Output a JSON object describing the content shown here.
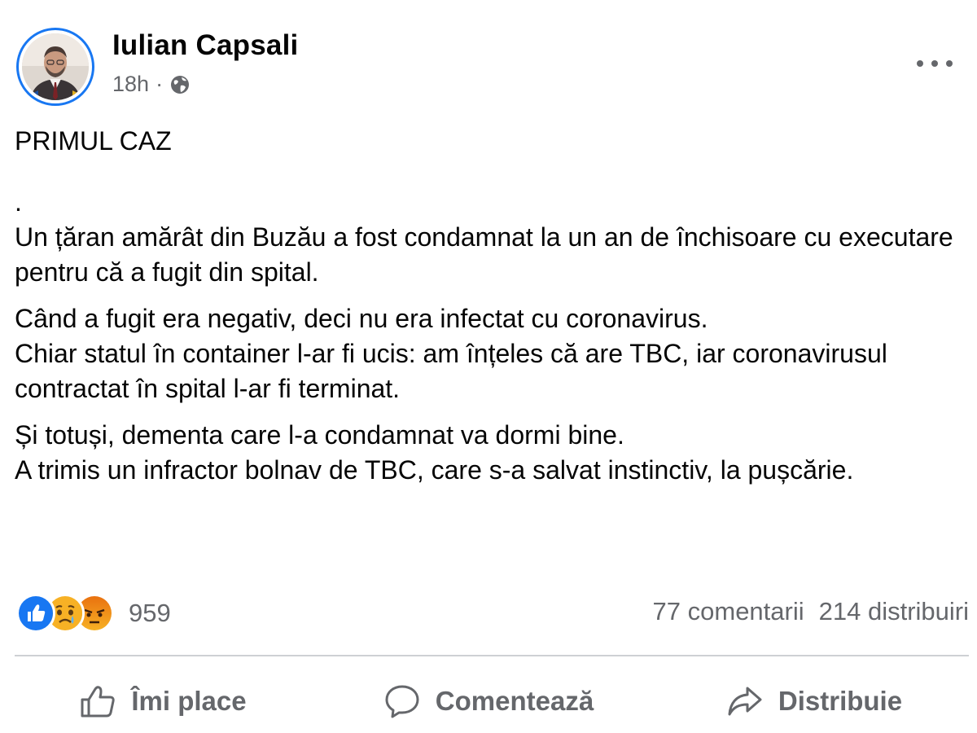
{
  "post": {
    "author": "Iulian Capsali",
    "time": "18h",
    "separator": "·",
    "privacy_icon": "globe-icon",
    "body": {
      "title": "PRIMUL CAZ",
      "dot": ".",
      "p1": "Un țăran amărât din Buzău a fost condamnat la un an de închisoare cu executare pentru că a fugit din spital.",
      "p2_l1": "Când a fugit era negativ, deci nu era infectat cu coronavirus.",
      "p2_l2": "Chiar statul în container l-ar fi ucis: am înțeles că are TBC, iar coronavirusul contractat în spital l-ar fi terminat.",
      "p3_l1": "Și totuși, dementa care l-a condamnat va dormi bine.",
      "p3_l2": "A trimis un infractor bolnav de TBC, care s-a salvat instinctiv, la pușcărie."
    },
    "reactions": {
      "icons": [
        "like-icon",
        "sad-icon",
        "angry-icon"
      ],
      "count": "959"
    },
    "stats": {
      "comments": "77 comentarii",
      "shares": "214 distribuiri"
    },
    "actions": {
      "like": "Îmi place",
      "comment": "Comentează",
      "share": "Distribuie"
    }
  },
  "colors": {
    "accent": "#1877f2",
    "secondary_text": "#65676b",
    "divider": "#ced0d4"
  }
}
